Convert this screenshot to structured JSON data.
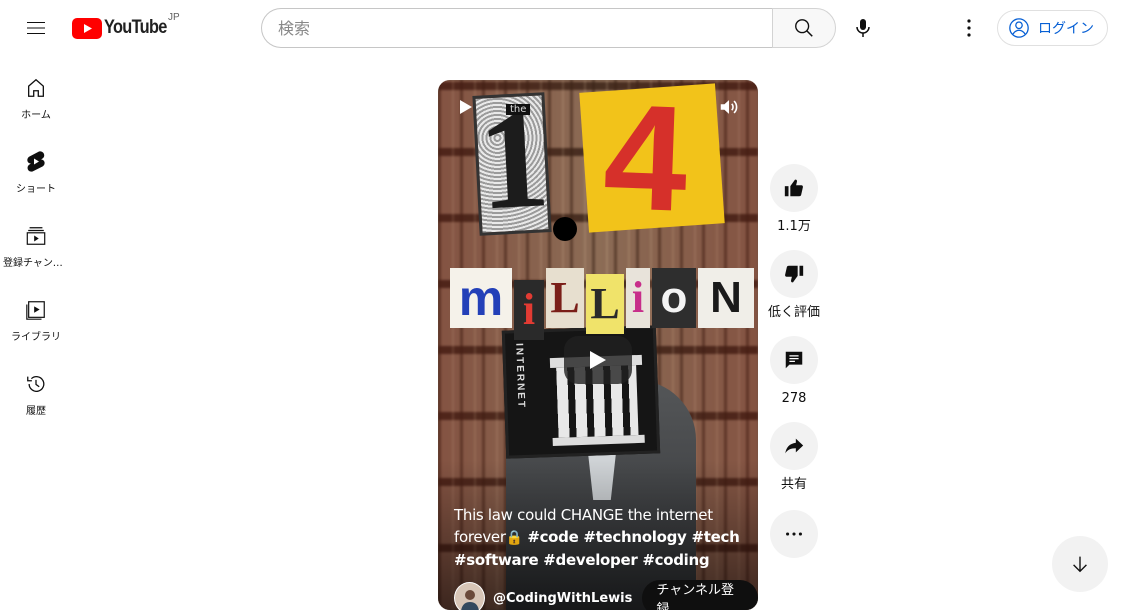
{
  "header": {
    "logo_text": "YouTube",
    "country_code": "JP",
    "search_placeholder": "検索",
    "login_label": "ログイン"
  },
  "sidebar": {
    "items": [
      {
        "label": "ホーム",
        "icon": "home-icon"
      },
      {
        "label": "ショート",
        "icon": "shorts-icon"
      },
      {
        "label": "登録チャンネル",
        "icon": "subscriptions-icon"
      },
      {
        "label": "ライブラリ",
        "icon": "library-icon"
      },
      {
        "label": "履歴",
        "icon": "history-icon"
      }
    ]
  },
  "short": {
    "title_plain": "This law could CHANGE the internet forever",
    "title_emoji": "🔒",
    "hashtags": "#code #technology #tech #software #developer #coding",
    "channel": "@CodingWithLewis",
    "subscribe_label": "チャンネル登録",
    "video_text": {
      "the": "the",
      "one": "1",
      "four": "4",
      "million": [
        "m",
        "i",
        "L",
        "L",
        "i",
        "o",
        "N"
      ],
      "internet": "INTERNET"
    }
  },
  "actions": {
    "like_count": "1.1万",
    "dislike_label": "低く評価",
    "comment_count": "278",
    "share_label": "共有"
  },
  "colors": {
    "brand_red": "#ff0000",
    "link_blue": "#065fd4",
    "four_card": "#f2c31a",
    "four_text": "#d6302a"
  }
}
